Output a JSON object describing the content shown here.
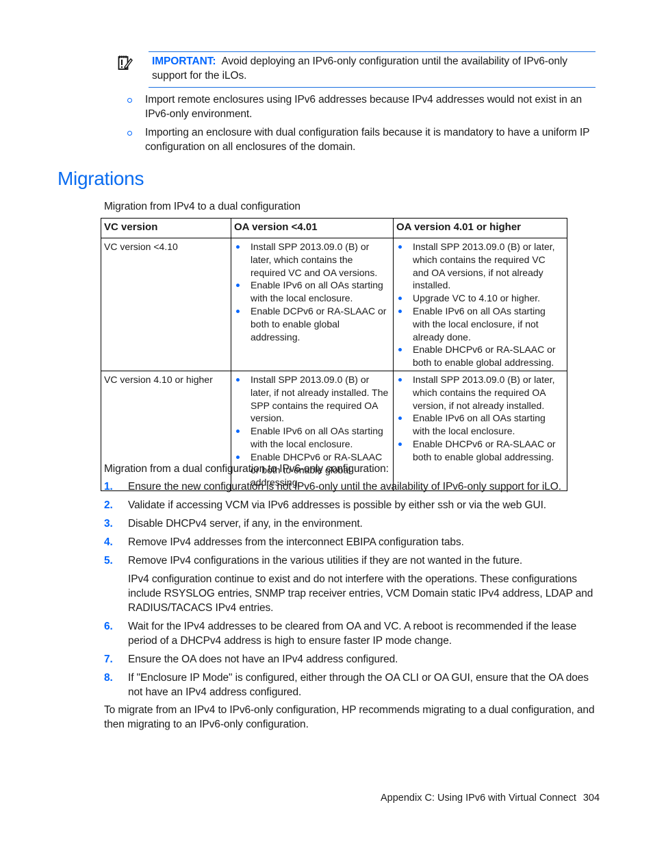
{
  "note": {
    "icon": "notepad-pencil-icon",
    "label": "IMPORTANT:",
    "text": "Avoid deploying an IPv6-only configuration until the availability of IPv6-only support for the iLOs."
  },
  "sub_bullets": [
    "Import remote enclosures using IPv6 addresses because IPv4 addresses would not exist in an IPv6-only environment.",
    "Importing an enclosure with dual configuration fails because it is mandatory to have a uniform IP configuration on all enclosures of the domain."
  ],
  "section": {
    "heading": "Migrations",
    "table_caption": "Migration from IPv4 to a dual configuration"
  },
  "table": {
    "headers": [
      "VC version",
      "OA version <4.01",
      "OA version 4.01 or higher"
    ],
    "rows": [
      {
        "vc": "VC version <4.10",
        "oa_below": [
          "Install SPP 2013.09.0 (B) or later, which contains the required VC and OA versions.",
          "Enable IPv6 on all OAs starting with the local enclosure.",
          "Enable DCPv6 or RA-SLAAC or both to enable global addressing."
        ],
        "oa_above": [
          "Install SPP 2013.09.0 (B) or later, which contains the required VC and OA versions, if not already installed.",
          "Upgrade VC to 4.10 or higher.",
          "Enable IPv6 on all OAs starting with the local enclosure, if not already done.",
          "Enable DHCPv6 or RA-SLAAC or both to enable global addressing."
        ]
      },
      {
        "vc": "VC version 4.10 or higher",
        "oa_below": [
          "Install SPP 2013.09.0 (B) or later, if not already installed. The SPP contains the required OA version.",
          "Enable IPv6 on all OAs starting with the local enclosure.",
          "Enable DHCPv6 or RA-SLAAC or both to enable global addressing."
        ],
        "oa_above": [
          "Install SPP 2013.09.0 (B) or later, which contains the required OA version, if not already installed.",
          "Enable IPv6 on all OAs starting with the local enclosure.",
          "Enable DHCPv6 or RA-SLAAC or both to enable global addressing."
        ]
      }
    ]
  },
  "dual_to_v6": {
    "intro": "Migration from a dual configuration to IPv6-only configuration:",
    "steps": [
      {
        "num": "1.",
        "text": "Ensure the new configuration is not IPv6-only until the availability of IPv6-only support for iLO."
      },
      {
        "num": "2.",
        "text": "Validate if accessing VCM via IPv6 addresses is possible by either ssh or via the web GUI."
      },
      {
        "num": "3.",
        "text": "Disable DHCPv4 server, if any, in the environment."
      },
      {
        "num": "4.",
        "text": "Remove IPv4 addresses from the interconnect EBIPA configuration tabs."
      },
      {
        "num": "5.",
        "text": "Remove IPv4 configurations in the various utilities if they are not wanted in the future.",
        "extra": "IPv4 configuration continue to exist and do not interfere with the operations. These configurations include RSYSLOG entries, SNMP trap receiver entries, VCM Domain static IPv4 address, LDAP and RADIUS/TACACS IPv4 entries."
      },
      {
        "num": "6.",
        "text": "Wait for the IPv4 addresses to be cleared from OA and VC. A reboot is recommended if the lease period of a DHCPv4 address is high to ensure faster IP mode change."
      },
      {
        "num": "7.",
        "text": "Ensure the OA does not have an IPv4 address configured."
      },
      {
        "num": "8.",
        "text": "If \"Enclosure IP Mode\" is configured, either through the OA CLI or OA GUI, ensure that the OA does not have an IPv4 address configured."
      }
    ],
    "closing": "To migrate from an IPv4 to IPv6-only configuration, HP recommends migrating to a dual configuration, and then migrating to an IPv6-only configuration."
  },
  "footer": {
    "chapter": "Appendix C: Using IPv6 with Virtual Connect",
    "page": "304"
  },
  "colors": {
    "accent": "#0066ff",
    "heading": "#0a6cf0",
    "text": "#1a1a1a"
  }
}
